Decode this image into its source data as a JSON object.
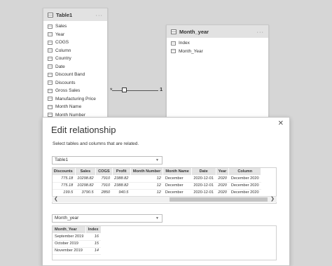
{
  "model": {
    "table1": {
      "name": "Table1",
      "menu": "···",
      "fields": [
        "Sales",
        "Year",
        "COGS",
        "Column",
        "Country",
        "Date",
        "Discount Band",
        "Discounts",
        "Gross Sales",
        "Manufacturing Price",
        "Month Name",
        "Month Number"
      ]
    },
    "month_year": {
      "name": "Month_year",
      "menu": "···",
      "fields": [
        "Index",
        "Month_Year"
      ]
    },
    "relationship": {
      "many": "*",
      "one": "1"
    }
  },
  "dialog": {
    "title": "Edit relationship",
    "close": "✕",
    "description": "Select tables and columns that are related.",
    "dropdown1": {
      "value": "Table1"
    },
    "grid1": {
      "headers": [
        "Discounts",
        "Sales",
        "COGS",
        "Profit",
        "Month Number",
        "Month Name",
        "Date",
        "Year",
        "Column"
      ],
      "rows": [
        [
          "24",
          "775.18",
          "10298.82",
          "7910",
          "2388.82",
          "12",
          "December",
          "2020-12-01",
          "2020",
          "December 2020"
        ],
        [
          "24",
          "775.18",
          "10298.82",
          "7910",
          "2388.82",
          "12",
          "December",
          "2020-12-01",
          "2020",
          "December 2020"
        ],
        [
          "00",
          "199.5",
          "3790.5",
          "2850",
          "940.5",
          "12",
          "December",
          "2020-12-01",
          "2020",
          "December 2020"
        ]
      ]
    },
    "dropdown2": {
      "value": "Month_year"
    },
    "grid2": {
      "headers": [
        "Month_Year",
        "Index"
      ],
      "rows": [
        [
          "September 2019",
          "16"
        ],
        [
          "October 2019",
          "15"
        ],
        [
          "November 2019",
          "14"
        ]
      ]
    }
  }
}
